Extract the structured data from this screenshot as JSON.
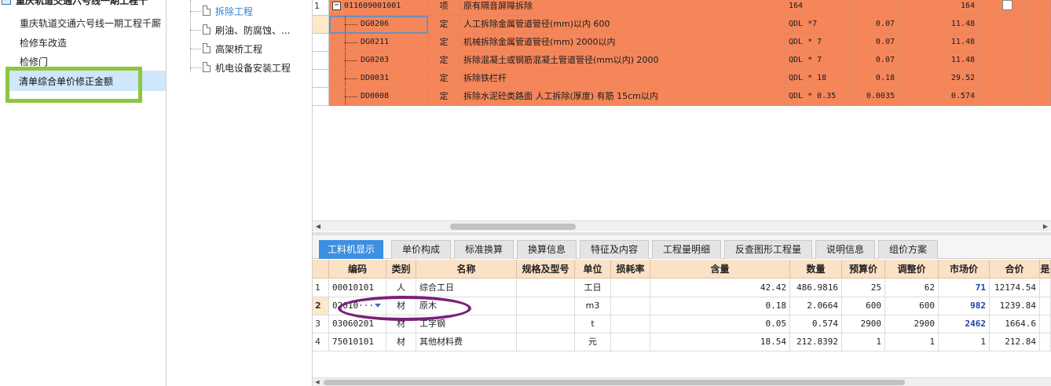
{
  "project_tree": {
    "root": "重庆轨道交通六号线一期工程十",
    "items": [
      "重庆轨道交通六号线一期工程千厮",
      "检修车改造",
      "检修门"
    ],
    "selected": "清单综合单价修正金额"
  },
  "category_tree": {
    "items": [
      "拆除工程",
      "刷油、防腐蚀、...",
      "高架桥工程",
      "机电设备安装工程"
    ],
    "active_index": 0
  },
  "top_grid": {
    "rows": [
      {
        "num": "1",
        "code": "011609001001",
        "type": "项",
        "name": "原有隔音屏障拆除",
        "expr": "164",
        "content": "",
        "qty": "164"
      },
      {
        "num": "",
        "code": "DG0206",
        "type": "定",
        "name": "人工拆除金属管道管径(mm)以内 600",
        "expr": "QDL *7",
        "content": "0.07",
        "qty": "11.48"
      },
      {
        "num": "",
        "code": "DG0211",
        "type": "定",
        "name": "机械拆除金属管道管径(mm) 2000以内",
        "expr": "QDL * 7",
        "content": "0.07",
        "qty": "11.48"
      },
      {
        "num": "",
        "code": "DG0203",
        "type": "定",
        "name": "拆除混凝土或钢筋混凝土管道管径(mm以内) 2000",
        "expr": "QDL * 7",
        "content": "0.07",
        "qty": "11.48"
      },
      {
        "num": "",
        "code": "DD0031",
        "type": "定",
        "name": "拆除铁栏杆",
        "expr": "QDL * 18",
        "content": "0.18",
        "qty": "29.52"
      },
      {
        "num": "",
        "code": "DD0008",
        "type": "定",
        "name": "拆除水泥砼类路面 人工拆除(厚度) 有筋 15cm以内",
        "expr": "QDL * 0.35",
        "content": "0.0035",
        "qty": "0.574"
      }
    ]
  },
  "tabs": [
    "工料机显示",
    "单价构成",
    "标准换算",
    "换算信息",
    "特征及内容",
    "工程量明细",
    "反查图形工程量",
    "说明信息",
    "组价方案"
  ],
  "bottom_grid": {
    "headers": [
      "编码",
      "类别",
      "名称",
      "规格及型号",
      "单位",
      "损耗率",
      "含量",
      "数量",
      "预算价",
      "调整价",
      "市场价",
      "合价",
      "是"
    ],
    "rows": [
      {
        "num": "1",
        "code": "00010101",
        "cat": "人",
        "name": "综合工日",
        "spec": "",
        "unit": "工日",
        "loss": "",
        "content": "42.42",
        "qty": "486.9816",
        "budget": "25",
        "adjust": "62",
        "market": "71",
        "total": "12174.54"
      },
      {
        "num": "2",
        "code": "02010···",
        "cat": "材",
        "name": "原木",
        "spec": "",
        "unit": "m3",
        "loss": "",
        "content": "0.18",
        "qty": "2.0664",
        "budget": "600",
        "adjust": "600",
        "market": "982",
        "total": "1239.84"
      },
      {
        "num": "3",
        "code": "03060201",
        "cat": "材",
        "name": "工字钢",
        "spec": "",
        "unit": "t",
        "loss": "",
        "content": "0.05",
        "qty": "0.574",
        "budget": "2900",
        "adjust": "2900",
        "market": "2462",
        "total": "1664.6"
      },
      {
        "num": "4",
        "code": "75010101",
        "cat": "材",
        "name": "其他材料费",
        "spec": "",
        "unit": "元",
        "loss": "",
        "content": "18.54",
        "qty": "212.8392",
        "budget": "1",
        "adjust": "1",
        "market": "1",
        "total": "212.84"
      }
    ]
  },
  "colors": {
    "row_orange": "#f4865a",
    "tab_active": "#3d8fe0",
    "highlight_green": "#8dc63f",
    "annotation_purple": "#7b1f7a",
    "header_bg": "#fbe2c6",
    "market_price_blue": "#1c3faa"
  }
}
